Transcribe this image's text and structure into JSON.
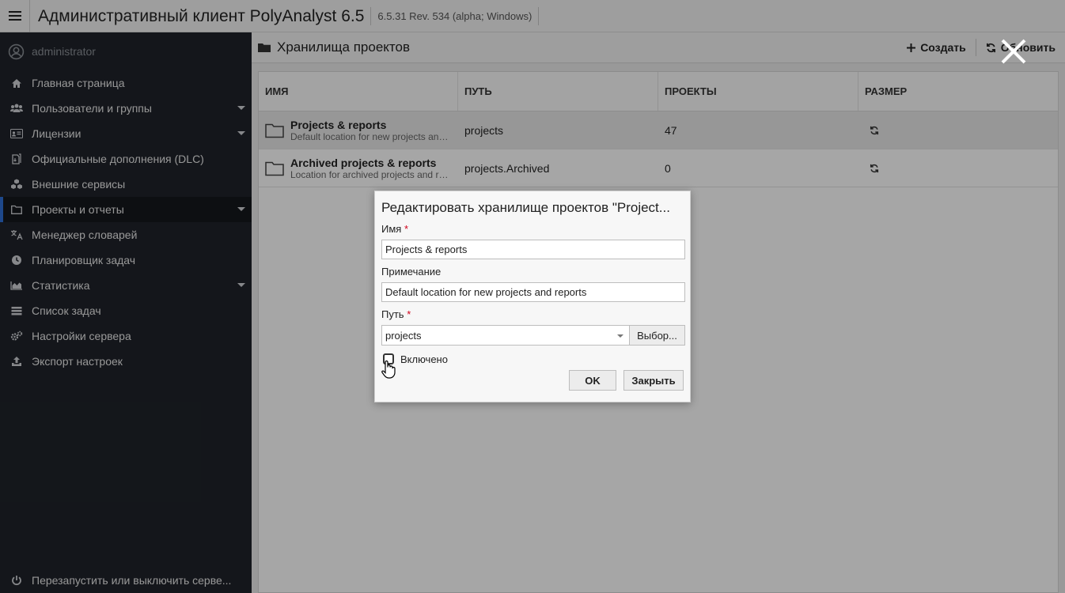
{
  "header": {
    "title": "Административный клиент PolyAnalyst 6.5",
    "version": "6.5.31 Rev. 534 (alpha; Windows)"
  },
  "sidebar": {
    "user": "administrator",
    "items": [
      {
        "label": "Главная страница",
        "icon": "home-icon"
      },
      {
        "label": "Пользователи и группы",
        "icon": "users-icon"
      },
      {
        "label": "Лицензии",
        "icon": "id-card-icon"
      },
      {
        "label": "Официальные дополнения (DLC)",
        "icon": "dlc-icon"
      },
      {
        "label": "Внешние сервисы",
        "icon": "cubes-icon"
      },
      {
        "label": "Проекты и отчеты",
        "icon": "folder-icon"
      },
      {
        "label": "Менеджер словарей",
        "icon": "translate-icon"
      },
      {
        "label": "Планировщик задач",
        "icon": "clock-icon"
      },
      {
        "label": "Статистика",
        "icon": "area-chart-icon"
      },
      {
        "label": "Список задач",
        "icon": "tasks-icon"
      },
      {
        "label": "Настройки сервера",
        "icon": "gears-icon"
      },
      {
        "label": "Экспорт настроек",
        "icon": "upload-icon"
      }
    ],
    "bottom": "Перезапустить или выключить серве..."
  },
  "main": {
    "title": "Хранилища проектов",
    "create_label": "Создать",
    "refresh_label": "Обновить",
    "columns": [
      "ИМЯ",
      "ПУТЬ",
      "ПРОЕКТЫ",
      "РАЗМЕР"
    ],
    "rows": [
      {
        "name": "Projects & reports",
        "desc": "Default location for new projects and reports",
        "path": "projects",
        "projects": "47"
      },
      {
        "name": "Archived projects & reports",
        "desc": "Location for archived projects and reports",
        "path": "projects.Archived",
        "projects": "0"
      }
    ]
  },
  "dialog": {
    "title": "Редактировать хранилище проектов \"Project...",
    "name_label": "Имя",
    "name_value": "Projects & reports",
    "note_label": "Примечание",
    "note_value": "Default location for new projects and reports",
    "path_label": "Путь",
    "path_value": "projects",
    "browse_label": "Выбор...",
    "enabled_label": "Включено",
    "ok_label": "OK",
    "close_label": "Закрыть",
    "required_mark": "*"
  },
  "colors": {
    "sidebar_bg": "#1f232a",
    "active_accent": "#2f6fd6",
    "required": "#d0021b"
  }
}
